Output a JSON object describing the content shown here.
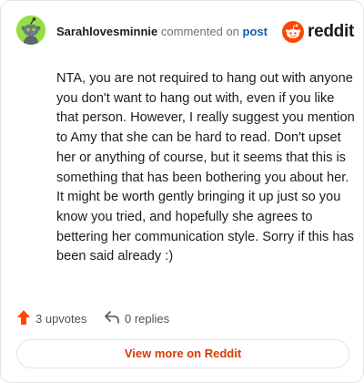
{
  "header": {
    "username": "Sarahlovesminnie",
    "action_text": "commented on",
    "post_link": "post",
    "brand": "reddit"
  },
  "comment": {
    "body": "NTA, you are not required to hang out with anyone you don't want to hang out with, even if you like that person. However, I really suggest you mention to Amy that she can be hard to read. Don't upset her or anything of course, but it seems that this is something that has been bothering you about her. It might be worth gently bringing it up just so you know you tried, and hopefully she agrees to bettering her communication style. Sorry if this has been said already :)"
  },
  "meta": {
    "upvotes": "3 upvotes",
    "replies": "0 replies"
  },
  "footer": {
    "view_more": "View more on Reddit"
  },
  "icons": {
    "avatar": "snoo-avatar-icon",
    "brand": "reddit-logo-icon",
    "upvote": "upvote-arrow-icon",
    "reply": "reply-arrow-icon"
  },
  "colors": {
    "avatar_bg": "#94e044",
    "brand_orange": "#ff4500",
    "link_blue": "#0f5fb0",
    "cta_text": "#d93a00",
    "border": "#e1e4e8"
  }
}
